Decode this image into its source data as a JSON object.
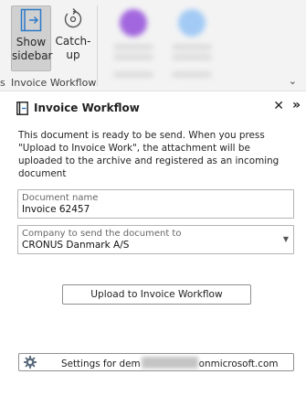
{
  "ribbon": {
    "left_stub": "s",
    "show_sidebar_line1": "Show",
    "show_sidebar_line2": "sidebar",
    "catchup_line1": "Catch-",
    "catchup_line2": "up",
    "group_label": "Invoice Workflow",
    "blurred_button_1": {
      "line1": "",
      "line2": "",
      "group": "",
      "color": "#8e44d9"
    },
    "blurred_button_2": {
      "line1": "",
      "line2": "",
      "group": "",
      "color": "#5aa2f2"
    }
  },
  "pane": {
    "title": "Invoice Workflow",
    "info": "This document is ready to be send. When you press \"Upload to Invoice Work\", the attachment will be uploaded to the archive and registered as an incoming document",
    "document_name": {
      "label": "Document name",
      "value": "Invoice 62457"
    },
    "company": {
      "label": "Company to send the document to",
      "value": "CRONUS Danmark A/S"
    },
    "upload_button": "Upload to Invoice Workflow",
    "settings": {
      "prefix": "Settings for dem",
      "suffix": "onmicrosoft.com"
    }
  },
  "icons": [
    "sidebar-icon",
    "catchup-icon",
    "workflow-icon",
    "close-icon",
    "expand-icon",
    "dropdown-icon",
    "gear-icon",
    "ribbon-collapse-icon"
  ]
}
